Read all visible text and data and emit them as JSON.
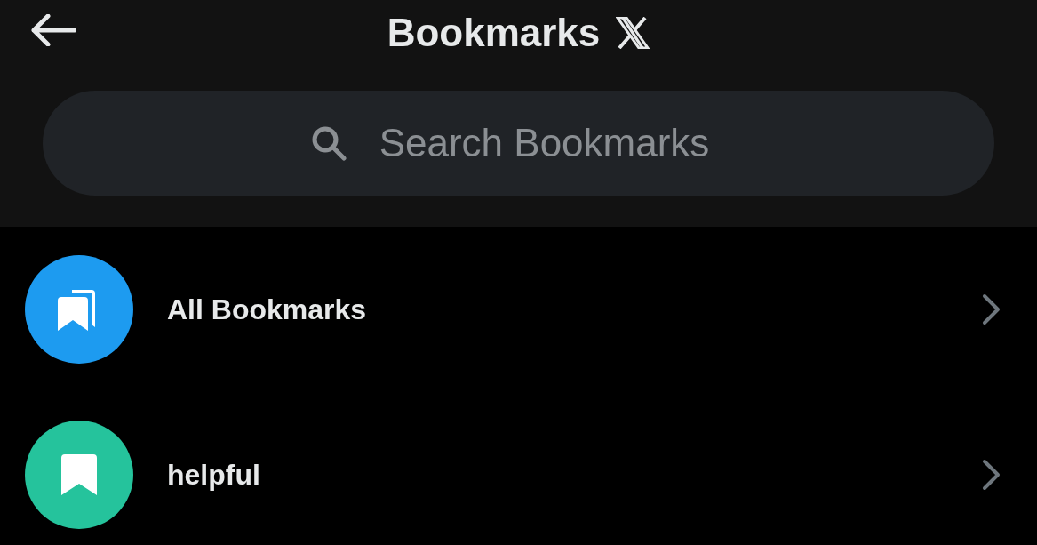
{
  "header": {
    "title": "Bookmarks"
  },
  "search": {
    "placeholder": "Search Bookmarks"
  },
  "lists": [
    {
      "kind": "all",
      "label": "All Bookmarks",
      "color": "#1d9bf0"
    },
    {
      "kind": "folder",
      "label": "helpful",
      "color": "#25c39c"
    }
  ]
}
